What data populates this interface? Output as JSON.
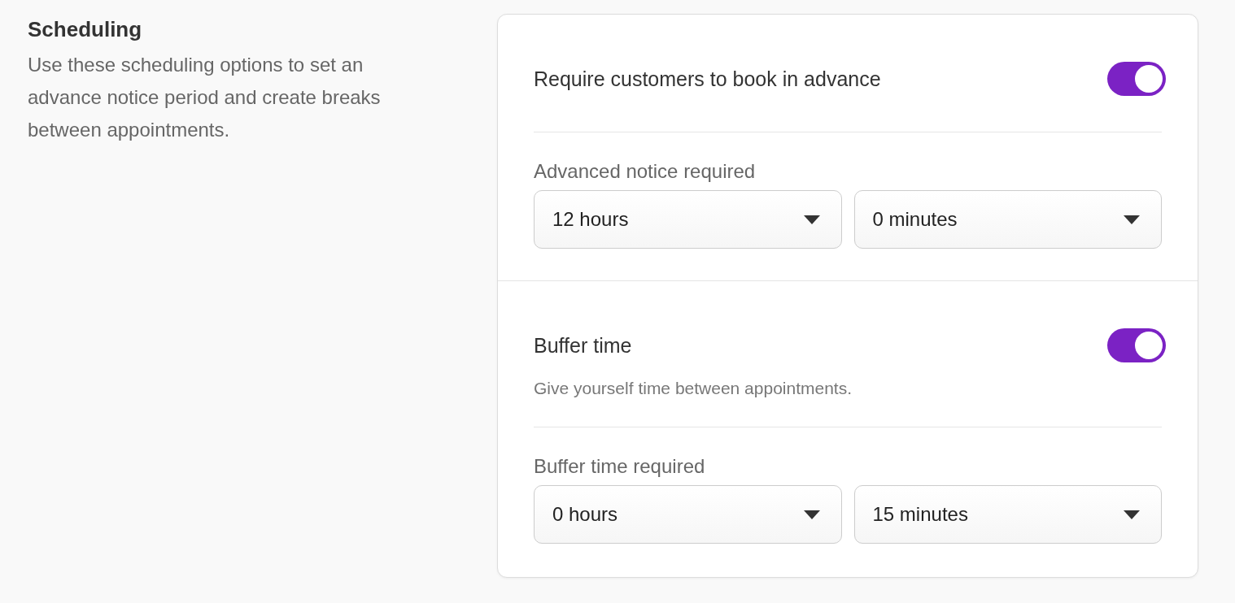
{
  "section": {
    "title": "Scheduling",
    "description": "Use these scheduling options to set an advance notice period and create breaks between appointments."
  },
  "groups": [
    {
      "toggle": {
        "label": "Require customers to book in advance",
        "on": true
      },
      "field": {
        "label": "Advanced notice required",
        "selects": [
          {
            "value": "12 hours"
          },
          {
            "value": "0 minutes"
          }
        ]
      }
    },
    {
      "toggle": {
        "label": "Buffer time",
        "on": true
      },
      "hint": "Give yourself time between appointments.",
      "field": {
        "label": "Buffer time required",
        "selects": [
          {
            "value": "0 hours"
          },
          {
            "value": "15 minutes"
          }
        ]
      }
    }
  ]
}
